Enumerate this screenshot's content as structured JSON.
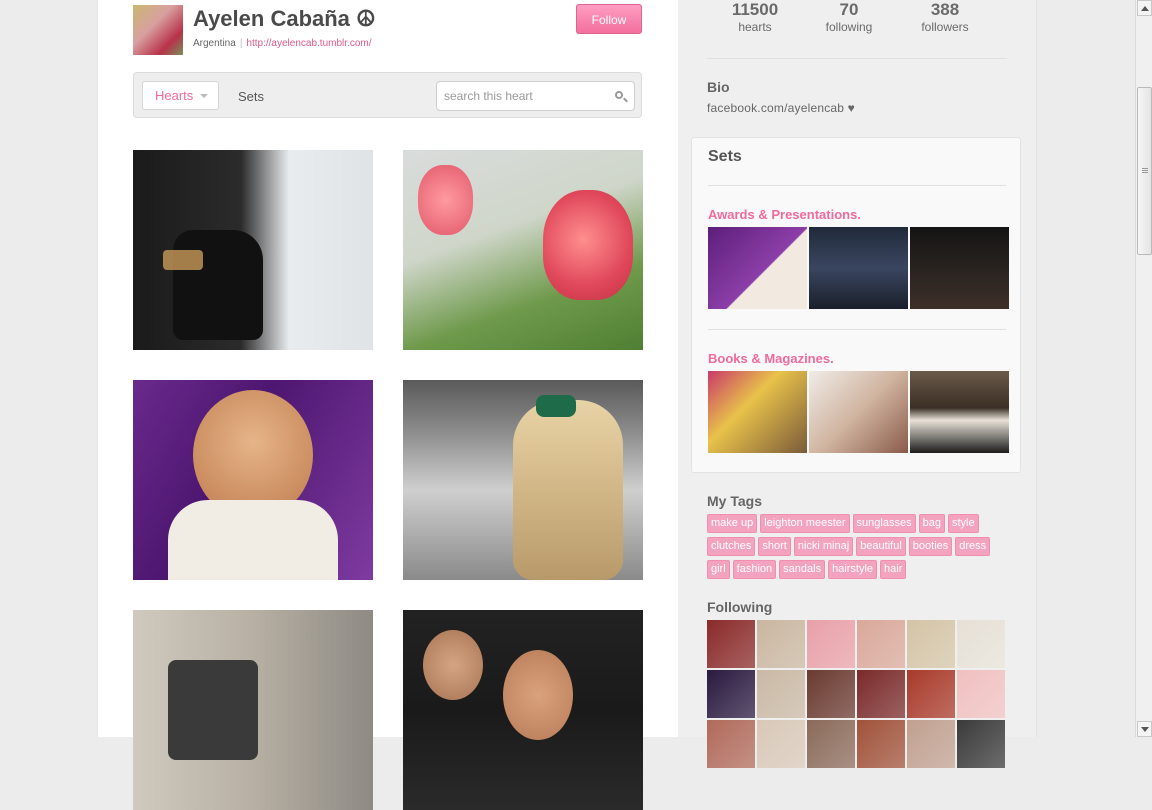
{
  "profile": {
    "name": "Ayelen Cabaña ☮",
    "location": "Argentina",
    "separator": "|",
    "url": "http://ayelencab.tumblr.com/",
    "follow_label": "Follow"
  },
  "toolbar": {
    "hearts_label": "Hearts",
    "sets_label": "Sets",
    "search_placeholder": "search this heart"
  },
  "stats": [
    {
      "value": "11500",
      "label": "hearts"
    },
    {
      "value": "70",
      "label": "following"
    },
    {
      "value": "388",
      "label": "followers"
    }
  ],
  "bio": {
    "heading": "Bio",
    "text": "facebook.com/ayelencab ♥"
  },
  "sets": {
    "heading": "Sets",
    "items": [
      {
        "title": "Awards & Presentations."
      },
      {
        "title": "Books & Magazines."
      }
    ]
  },
  "tags": {
    "heading": "My Tags",
    "items": [
      "make up",
      "leighton meester",
      "sunglasses",
      "bag",
      "style",
      "clutches",
      "short",
      "nicki minaj",
      "beautiful",
      "booties",
      "dress",
      "girl",
      "fashion",
      "sandals",
      "hairstyle",
      "hair"
    ]
  },
  "following": {
    "heading": "Following",
    "avatar_colors": [
      "#8a2a2a",
      "#c9b6a0",
      "#e8a0a8",
      "#d9a89a",
      "#d4c4a6",
      "#e6e0d6",
      "#2a1a40",
      "#c9b8a4",
      "#6a3a30",
      "#7a2a2a",
      "#a83a2a",
      "#f0c0c0",
      "#b06a5a",
      "#d8c8b8",
      "#8a6a5a",
      "#a0523a",
      "#c0a090",
      "#3a3a3a"
    ]
  },
  "colors": {
    "accent": "#f06b9c",
    "tag_bg": "#f4a3be"
  }
}
